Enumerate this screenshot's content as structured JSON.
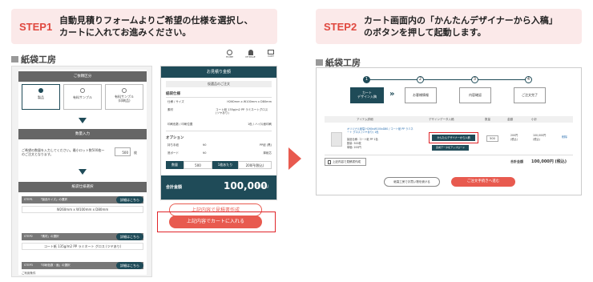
{
  "step1": {
    "tag": "STEP1",
    "line1": "自動見積りフォームよりご希望の仕様を選択し、",
    "line2": "カートに入れてお進みください。"
  },
  "step2": {
    "tag": "STEP2",
    "line1": "カート画面内の「かんたんデザイナーから入稿」",
    "line2": "のボタンを押して起動します。"
  },
  "logo": "紙袋工房",
  "header_icons": [
    "HOME",
    "MYPAGE",
    "CART"
  ],
  "left": {
    "section1": "ご依頼区分",
    "radio_options": [
      "製品",
      "有料サンプル",
      "有料サンプル\n(印刷品)"
    ],
    "section2": "数量入力",
    "qty_text": "ご希望の数量を入力してください。最小ロット数500枚〜のご注文となります。",
    "qty_value": "500",
    "qty_unit": "枚",
    "section3": "紙袋仕様選択",
    "spec_rows": [
      {
        "step": "STEP1",
        "label": "「製品サイズ」の選択",
        "value": "W260mm x W100mm x D80mm",
        "btn": "詳細はこちら"
      },
      {
        "step": "STEP2",
        "label": "「素材」の選択",
        "value": "コート紙 135g/m2 PP ラミネート グロス (ツヤあり)",
        "btn": "詳細はこちら"
      },
      {
        "step": "STEP3",
        "label": "「印刷色数・面」の選択",
        "value": "",
        "btn": "詳細はこちら"
      }
    ],
    "footer_note": "ご利用条件"
  },
  "estimate": {
    "title": "お見積り金額",
    "subtitle": "仮選品のご注文",
    "group1": "紙袋仕様",
    "rows": [
      {
        "k": "仕様 / サイズ",
        "v": "H260mm x W100mm x D80mm"
      },
      {
        "k": "素材",
        "v": "コート紙 135g/m2 PP ラミネートグロス (ツヤあり)"
      },
      {
        "k": "印刷色数 / 印刷位置",
        "v": "1色 / ハイ片面印刷"
      }
    ],
    "group2": "オプション",
    "opt_rows": [
      {
        "k": "持ち手紐",
        "a": "¥0",
        "b": "PP紐 (黒)"
      },
      {
        "k": "底ボード",
        "a": "¥0",
        "b": "厚紙芯"
      }
    ],
    "qty_label": "数量",
    "qty": "500",
    "unit_label": "1枚あたり",
    "unit_price": "200円(税込)",
    "total_label": "合計金額",
    "total": "100,000",
    "total_suffix": "円 (税込)"
  },
  "left_buttons": {
    "quote": "上記内容で見積書作成",
    "cart": "上記内容でカートに入れる"
  },
  "cart": {
    "steps": [
      "カート\nデザイン入稿",
      "お客様情報",
      "内容確認",
      "ご注文完了"
    ],
    "headers": [
      "アイテム詳細",
      "デザインデータ入稿",
      "数量",
      "金額",
      "小計"
    ],
    "item_desc": "オリジナル紙袋 H260xW100xD80 / コート紙 PP ラミネート グロス (ツヤあり) 1色",
    "item_sub1": "製品仕様: コート紙 PP 1色",
    "item_sub2": "数量: 500枚",
    "item_sub3": "単価: 200円",
    "designer_btn": "かんたんデザイナーから入稿",
    "upload_btn": "完成データをアップロード",
    "qty": "500",
    "price": "200円\n(税込)",
    "subtotal": "100,000円\n(税込)",
    "delete": "削除",
    "save_btn": "上記内容で見積書作成",
    "total_label": "合計金額",
    "total": "100,000円 (税込)",
    "back_btn": "紙袋工房でお買い物を続ける",
    "checkout_btn": "ご注文手続きへ進む"
  }
}
